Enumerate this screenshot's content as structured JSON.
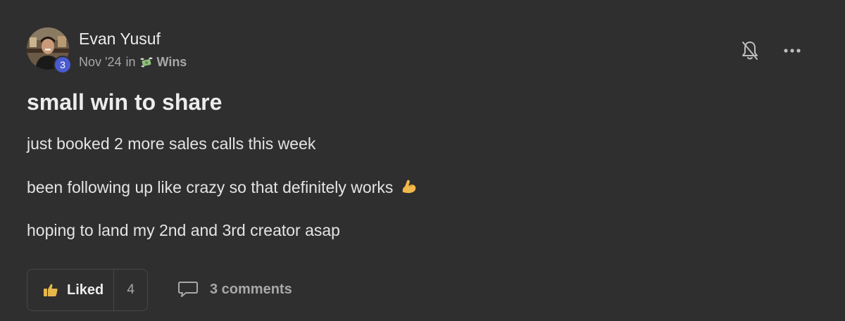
{
  "author": {
    "name": "Evan Yusuf",
    "level": "3",
    "avatar_icon": "avatar-photo"
  },
  "meta": {
    "date": "Nov '24",
    "in_word": "in",
    "category": "Wins",
    "category_icon": "money-with-wings-icon"
  },
  "post": {
    "title": "small win to share",
    "paragraphs": [
      "just booked 2 more sales calls this week",
      "been following up like crazy so that definitely works",
      "hoping to land my 2nd and 3rd creator asap"
    ],
    "emoji": "flexed-biceps-icon"
  },
  "actions": {
    "like_label": "Liked",
    "like_count": "4",
    "comments_label": "3 comments"
  },
  "colors": {
    "background": "#2f2f2f",
    "badge": "#4a5bd0",
    "text": "#ececec",
    "muted": "#a8a8a8",
    "like_icon": "#e6b84a"
  }
}
